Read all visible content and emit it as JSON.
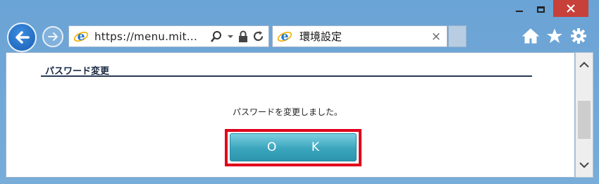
{
  "browser": {
    "address_url": "https://menu.mit...",
    "tab_title": "環境設定",
    "tab_close": "×"
  },
  "page": {
    "section_title": "パスワード変更",
    "message": "パスワードを変更しました。",
    "ok_label": "O K"
  },
  "icons": [
    "minimize-icon",
    "maximize-icon",
    "close-icon",
    "back-arrow-icon",
    "forward-arrow-icon",
    "ie-icon",
    "search-icon",
    "dropdown-arrow-icon",
    "lock-icon",
    "refresh-icon",
    "home-icon",
    "favorites-star-icon",
    "settings-gear-icon",
    "scroll-up-icon",
    "scroll-down-icon"
  ],
  "colors": {
    "highlight": "#e0001b",
    "ok_button": "#3aa5bd",
    "frame": "#6fa6d6"
  }
}
